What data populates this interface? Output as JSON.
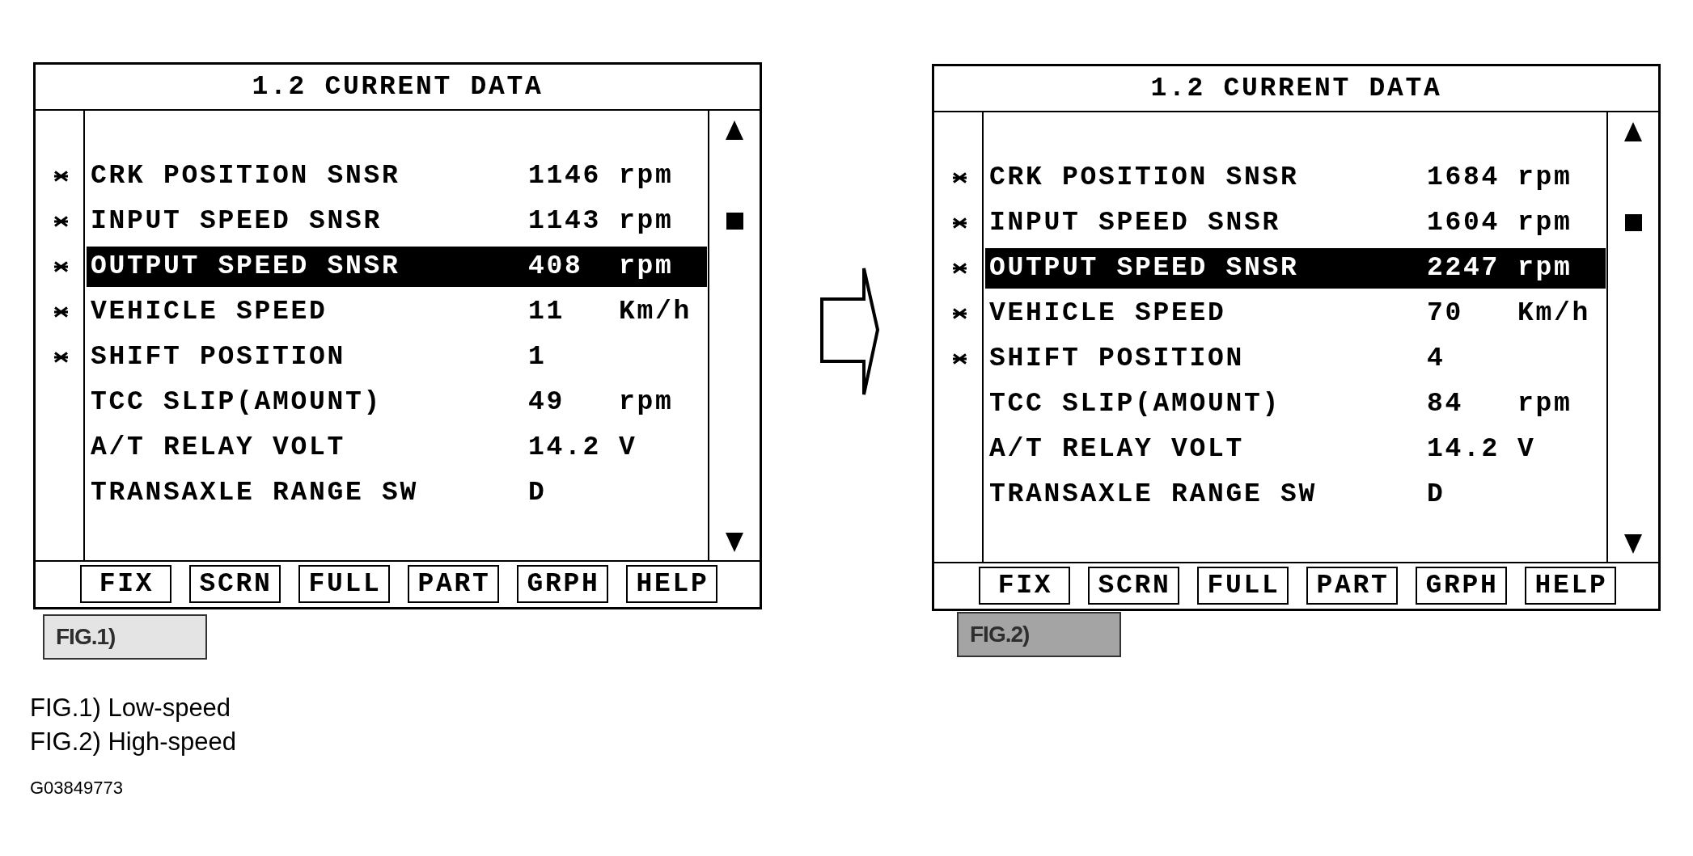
{
  "figures": [
    {
      "title": "1.2 CURRENT DATA",
      "rows": [
        {
          "marked": true,
          "label": "CRK POSITION SNSR",
          "value": "1146",
          "unit": "rpm",
          "selected": false
        },
        {
          "marked": true,
          "label": "INPUT SPEED SNSR",
          "value": "1143",
          "unit": "rpm",
          "selected": false
        },
        {
          "marked": true,
          "label": "OUTPUT SPEED SNSR",
          "value": "408",
          "unit": "rpm",
          "selected": true
        },
        {
          "marked": true,
          "label": "VEHICLE SPEED",
          "value": "11",
          "unit": "Km/h",
          "selected": false
        },
        {
          "marked": true,
          "label": "SHIFT POSITION",
          "value": "1",
          "selected": false
        },
        {
          "marked": false,
          "label": "TCC SLIP(AMOUNT)",
          "value": "49",
          "unit": "rpm",
          "selected": false
        },
        {
          "marked": false,
          "label": "A/T RELAY VOLT",
          "value": "14.2",
          "unit": "V",
          "selected": false
        },
        {
          "marked": false,
          "label": "TRANSAXLE RANGE SW",
          "value": "D",
          "selected": false
        }
      ],
      "buttons": [
        "FIX",
        "SCRN",
        "FULL",
        "PART",
        "GRPH",
        "HELP"
      ],
      "tag": {
        "text": "FIG.1)",
        "color": "#e4e4e4"
      }
    },
    {
      "title": "1.2 CURRENT DATA",
      "rows": [
        {
          "marked": true,
          "label": "CRK POSITION SNSR",
          "value": "1684",
          "unit": "rpm",
          "selected": false
        },
        {
          "marked": true,
          "label": "INPUT SPEED SNSR",
          "value": "1604",
          "unit": "rpm",
          "selected": false
        },
        {
          "marked": true,
          "label": "OUTPUT SPEED SNSR",
          "value": "2247",
          "unit": "rpm",
          "selected": true
        },
        {
          "marked": true,
          "label": "VEHICLE SPEED",
          "value": "70",
          "unit": "Km/h",
          "selected": false
        },
        {
          "marked": true,
          "label": "SHIFT POSITION",
          "value": "4",
          "selected": false
        },
        {
          "marked": false,
          "label": "TCC SLIP(AMOUNT)",
          "value": "84",
          "unit": "rpm",
          "selected": false
        },
        {
          "marked": false,
          "label": "A/T RELAY VOLT",
          "value": "14.2",
          "unit": "V",
          "selected": false
        },
        {
          "marked": false,
          "label": "TRANSAXLE RANGE SW",
          "value": "D",
          "selected": false
        }
      ],
      "buttons": [
        "FIX",
        "SCRN",
        "FULL",
        "PART",
        "GRPH",
        "HELP"
      ],
      "tag": {
        "text": "FIG.2)",
        "color": "#a4a4a4"
      }
    }
  ],
  "captions": [
    "FIG.1) Low-speed",
    "FIG.2) High-speed"
  ],
  "code": "G03849773"
}
